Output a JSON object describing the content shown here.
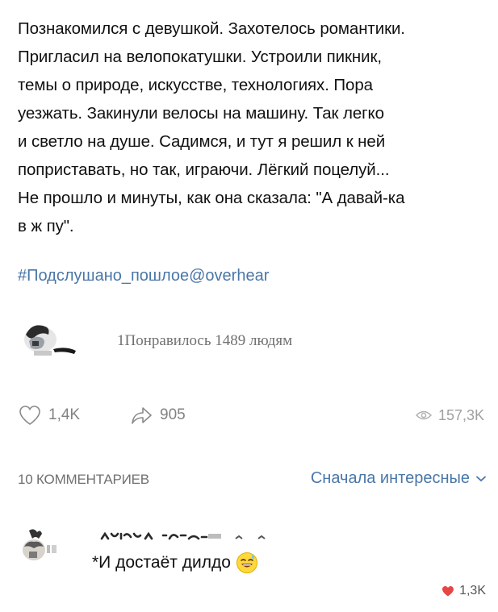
{
  "post": {
    "lines": [
      "Познакомился с девушкой. Захотелось романтики.",
      "Пригласил на велопокатушки. Устроили пикник,",
      "темы о природе, искусстве, технологиях. Пора",
      "уезжать. Закинули велосы на машину. Так легко",
      "и светло на душе. Садимся, и тут я решил к ней",
      "поприставать, но так, играючи. Лёгкий поцелуй...",
      "Не прошло и минуты, как она сказала: \"А давай-ка",
      "в ж   пу\"."
    ],
    "hashtag": "#Подслушано_пошлое@overhear"
  },
  "likes_summary": {
    "text": "1Понравилось 1489 людям"
  },
  "actions": {
    "like_count": "1,4K",
    "share_count": "905",
    "views_count": "157,3K"
  },
  "comments": {
    "count_label": "10 КОММЕНТАРИЕВ",
    "sort_label": "Сначала интересные",
    "items": [
      {
        "text": "*И достаёт дилдо",
        "like_count": "1,3K"
      }
    ]
  },
  "colors": {
    "link": "#4a76a8",
    "muted": "#828282",
    "heart": "#e64646"
  },
  "icons": {
    "like": "heart-outline-icon",
    "share": "share-arrow-icon",
    "views": "eye-icon",
    "sort": "chevron-down-icon",
    "comment_like": "heart-filled-icon",
    "emoji": "sweat-smile-emoji"
  }
}
